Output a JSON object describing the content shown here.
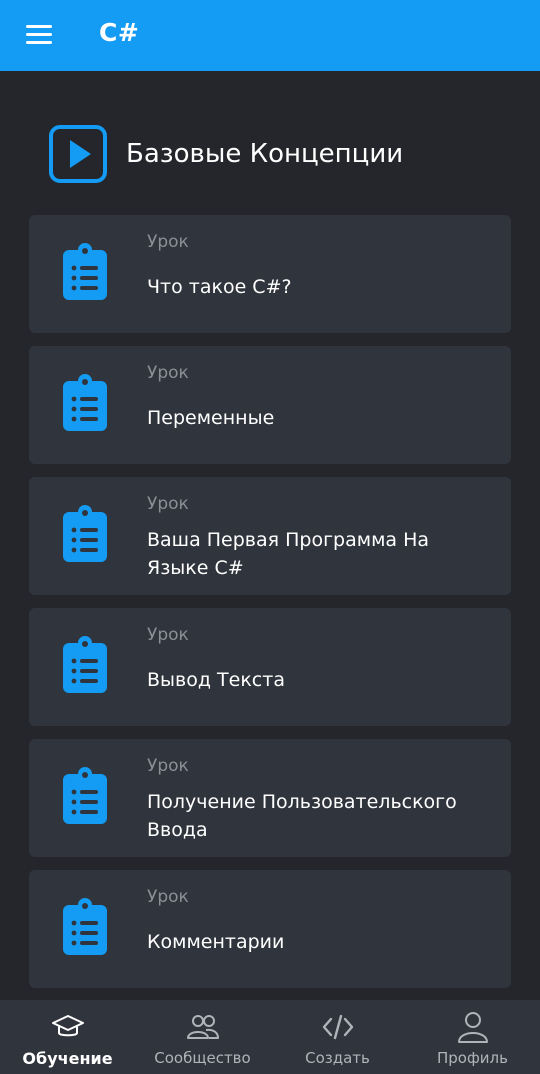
{
  "topbar": {
    "title": "C#"
  },
  "section": {
    "title": "Базовые Концепции"
  },
  "lessons": [
    {
      "kind": "Урок",
      "title": "Что такое C#?"
    },
    {
      "kind": "Урок",
      "title": "Переменные"
    },
    {
      "kind": "Урок",
      "title": "Ваша Первая Программа На Языке C#"
    },
    {
      "kind": "Урок",
      "title": "Вывод Текста"
    },
    {
      "kind": "Урок",
      "title": "Получение Пользовательского Ввода"
    },
    {
      "kind": "Урок",
      "title": "Комментарии"
    }
  ],
  "nav": {
    "items": [
      {
        "label": "Обучение",
        "icon": "graduation-cap-icon"
      },
      {
        "label": "Сообщество",
        "icon": "people-icon"
      },
      {
        "label": "Создать",
        "icon": "code-icon"
      },
      {
        "label": "Профиль",
        "icon": "user-icon"
      }
    ],
    "active": "Обучение"
  },
  "colors": {
    "accent": "#149bf3",
    "background": "#24262b",
    "card": "#30343c",
    "muted_text": "#8b8f96"
  }
}
